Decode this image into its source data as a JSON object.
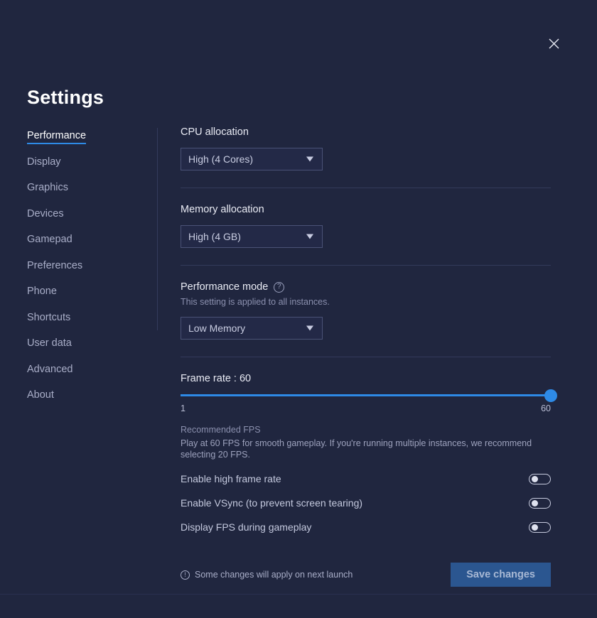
{
  "window": {
    "title": "Settings",
    "close_icon": "close-icon"
  },
  "sidebar": {
    "items": [
      {
        "label": "Performance",
        "active": true
      },
      {
        "label": "Display",
        "active": false
      },
      {
        "label": "Graphics",
        "active": false
      },
      {
        "label": "Devices",
        "active": false
      },
      {
        "label": "Gamepad",
        "active": false
      },
      {
        "label": "Preferences",
        "active": false
      },
      {
        "label": "Phone",
        "active": false
      },
      {
        "label": "Shortcuts",
        "active": false
      },
      {
        "label": "User data",
        "active": false
      },
      {
        "label": "Advanced",
        "active": false
      },
      {
        "label": "About",
        "active": false
      }
    ]
  },
  "main": {
    "cpu": {
      "label": "CPU allocation",
      "value": "High (4 Cores)"
    },
    "memory": {
      "label": "Memory allocation",
      "value": "High (4 GB)"
    },
    "performance_mode": {
      "label": "Performance mode",
      "help_icon": "help-circle-icon",
      "note": "This setting is applied to all instances.",
      "value": "Low Memory"
    },
    "frame_rate": {
      "label": "Frame rate : 60",
      "value": 60,
      "min_label": "1",
      "max_label": "60",
      "min": 1,
      "max": 60,
      "recommend_title": "Recommended FPS",
      "recommend_body": "Play at 60 FPS for smooth gameplay. If you're running multiple instances, we recommend selecting 20 FPS."
    },
    "toggles": [
      {
        "label": "Enable high frame rate",
        "on": false
      },
      {
        "label": "Enable VSync (to prevent screen tearing)",
        "on": false
      },
      {
        "label": "Display FPS during gameplay",
        "on": false
      }
    ]
  },
  "footer": {
    "info_icon": "info-icon",
    "note": "Some changes will apply on next launch",
    "save_label": "Save changes"
  },
  "colors": {
    "background": "#20263f",
    "accent": "#2e8ae6",
    "save_button": "#2b5690",
    "divider": "#333a5b"
  }
}
